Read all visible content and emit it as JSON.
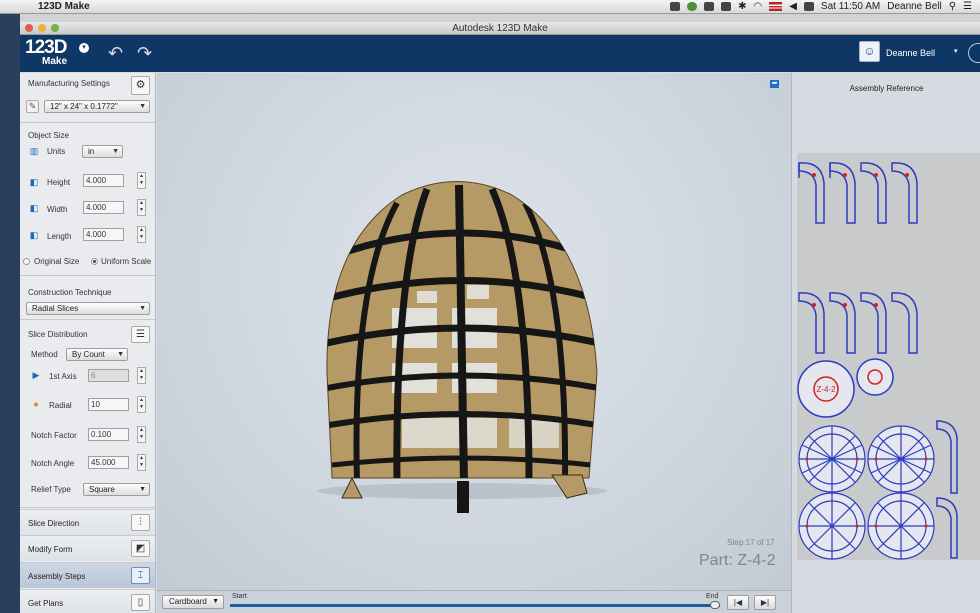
{
  "menubar": {
    "app_name": "123D Make",
    "clock": "Sat 11:50 AM",
    "user": "Deanne Bell",
    "icons": [
      "apple-icon",
      "dropbox-icon",
      "status-icon",
      "airplay-icon",
      "timemachine-icon",
      "bluetooth-icon",
      "wifi-icon",
      "flag-icon",
      "volume-icon",
      "battery-icon",
      "spotlight-icon",
      "list-icon"
    ]
  },
  "window": {
    "title": "Autodesk 123D Make"
  },
  "header": {
    "logo_big": "123D",
    "logo_small": "Make",
    "user_name": "Deanne Bell"
  },
  "settings": {
    "manufacturing_label": "Manufacturing Settings",
    "sheet_size": "12\" x 24\" x 0.1772\""
  },
  "object_size": {
    "title": "Object Size",
    "units_label": "Units",
    "units_value": "in",
    "height_label": "Height",
    "height_value": "4.000",
    "width_label": "Width",
    "width_value": "4.000",
    "length_label": "Length",
    "length_value": "4.000",
    "original_size": "Original Size",
    "uniform_scale": "Uniform Scale"
  },
  "construction": {
    "title": "Construction Technique",
    "value": "Radial Slices"
  },
  "slice_distribution": {
    "title": "Slice Distribution",
    "method_label": "Method",
    "method_value": "By Count",
    "axis1_label": "1st Axis",
    "axis1_value": "6",
    "radial_label": "Radial",
    "radial_value": "10",
    "notch_factor_label": "Notch Factor",
    "notch_factor_value": "0.100",
    "notch_angle_label": "Notch Angle",
    "notch_angle_value": "45.000",
    "relief_label": "Relief Type",
    "relief_value": "Square"
  },
  "nav": {
    "slice_direction": "Slice Direction",
    "modify_form": "Modify Form",
    "assembly_steps": "Assembly Steps",
    "get_plans": "Get Plans"
  },
  "viewport": {
    "step_text": "Step 17 of 17",
    "part_text": "Part: Z-4-2"
  },
  "timeline": {
    "material": "Cardboard",
    "start": "Start",
    "end": "End"
  },
  "reference": {
    "title": "Assembly Reference",
    "disc_label": "Z-4-2"
  },
  "colors": {
    "header": "#0f3766",
    "cardboard": "#b59a66",
    "slot": "#161616",
    "part_outline": "#2a3cc0",
    "part_marker": "#d62020",
    "accent": "#1c6ec7"
  }
}
